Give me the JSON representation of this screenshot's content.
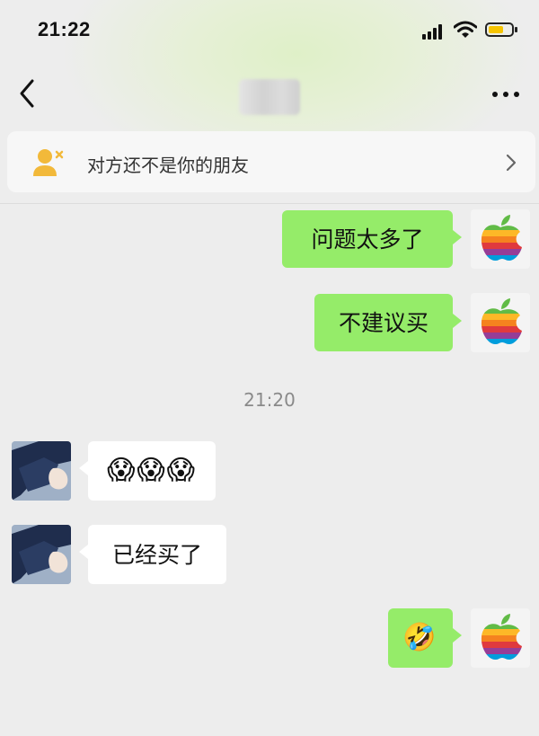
{
  "status_bar": {
    "time": "21:22"
  },
  "chat": {
    "banner": {
      "text": "对方还不是你的朋友"
    },
    "messages": [
      {
        "direction": "out",
        "text": "问题太多了"
      },
      {
        "direction": "out",
        "text": "不建议买"
      },
      {
        "type": "timestamp",
        "text": "21:20"
      },
      {
        "direction": "in",
        "text": "😱😱😱"
      },
      {
        "direction": "in",
        "text": "已经买了"
      },
      {
        "direction": "out",
        "text": "🤣"
      }
    ]
  },
  "colors": {
    "outgoing_bubble": "#95ec69",
    "incoming_bubble": "#ffffff",
    "background": "#ededed"
  },
  "icons": {
    "back": "back-chevron-icon",
    "more": "more-dots-icon",
    "banner": "user-not-friend-icon",
    "banner_arrow": "chevron-right-icon",
    "self_avatar": "rainbow-apple-logo",
    "contact_avatar": "contact-photo"
  }
}
